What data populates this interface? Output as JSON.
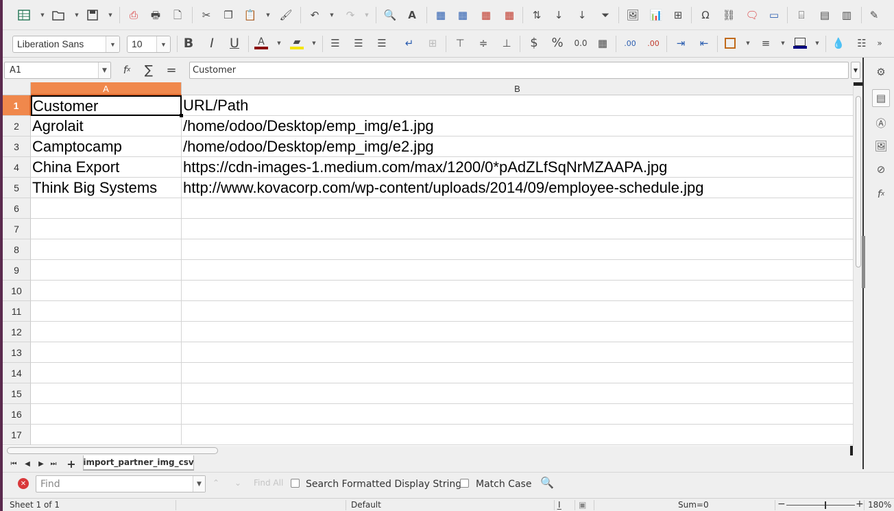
{
  "toolbar": {
    "font_name": "Liberation Sans",
    "font_size": "10"
  },
  "formula_bar": {
    "name_box": "A1",
    "content": "Customer"
  },
  "grid": {
    "columns": [
      "A",
      "B"
    ],
    "selected_column": "A",
    "selected_row": "1",
    "row_numbers": [
      "1",
      "2",
      "3",
      "4",
      "5",
      "6",
      "7",
      "8",
      "9",
      "10",
      "11",
      "12",
      "13",
      "14",
      "15",
      "16",
      "17"
    ],
    "rows": [
      [
        "Customer",
        "URL/Path"
      ],
      [
        "Agrolait",
        "/home/odoo/Desktop/emp_img/e1.jpg"
      ],
      [
        "Camptocamp",
        "/home/odoo/Desktop/emp_img/e2.jpg"
      ],
      [
        "China Export",
        "https://cdn-images-1.medium.com/max/1200/0*pAdZLfSqNrMZAAPA.jpg"
      ],
      [
        "Think Big Systems",
        "http://www.kovacorp.com/wp-content/uploads/2014/09/employee-schedule.jpg"
      ]
    ]
  },
  "sheet_tabs": {
    "active": "import_partner_img_csv"
  },
  "find_bar": {
    "placeholder": "Find",
    "find_all": "Find All",
    "search_formatted": "Search Formatted Display String",
    "match_case": "Match Case"
  },
  "status_bar": {
    "sheet": "Sheet 1 of 1",
    "page_style": "Default",
    "sum": "Sum=0",
    "zoom": "180%"
  },
  "colors": {
    "selection_header": "#f0884c",
    "accent_red": "#d9383a"
  }
}
